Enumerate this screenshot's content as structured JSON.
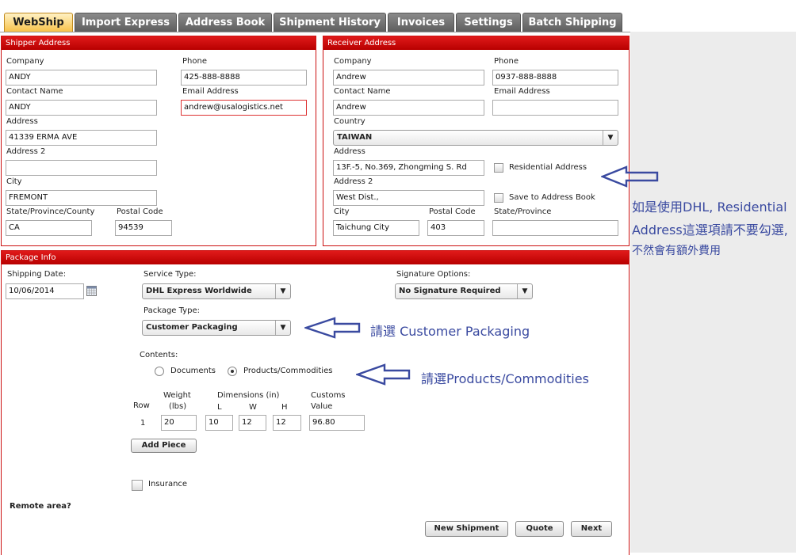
{
  "tabs": [
    "WebShip",
    "Import Express",
    "Address Book",
    "Shipment History",
    "Invoices",
    "Settings",
    "Batch Shipping"
  ],
  "shipper": {
    "title": "Shipper Address",
    "company_label": "Company",
    "company": "ANDY",
    "phone_label": "Phone",
    "phone": "425-888-8888",
    "contact_label": "Contact Name",
    "contact": "ANDY",
    "email_label": "Email Address",
    "email": "andrew@usalogistics.net",
    "address_label": "Address",
    "address": "41339 ERMA AVE",
    "address2_label": "Address 2",
    "address2": "",
    "city_label": "City",
    "city": "FREMONT",
    "state_label": "State/Province/County",
    "state": "CA",
    "postal_label": "Postal Code",
    "postal": "94539"
  },
  "receiver": {
    "title": "Receiver Address",
    "company_label": "Company",
    "company": "Andrew",
    "phone_label": "Phone",
    "phone": "0937-888-8888",
    "contact_label": "Contact Name",
    "contact": "Andrew",
    "email_label": "Email Address",
    "email": "",
    "country_label": "Country",
    "country": "TAIWAN",
    "address_label": "Address",
    "address": "13F.-5, No.369, Zhongming S. Rd",
    "residential_label": "Residential Address",
    "address2_label": "Address 2",
    "address2": "West Dist.,",
    "save_label": "Save to Address Book",
    "city_label": "City",
    "city": "Taichung City",
    "postal_label": "Postal Code",
    "postal": "403",
    "state_label": "State/Province",
    "state": ""
  },
  "package": {
    "title": "Package Info",
    "date_label": "Shipping Date:",
    "date": "10/06/2014",
    "service_label": "Service Type:",
    "service": "DHL Express Worldwide",
    "signature_label": "Signature Options:",
    "signature": "No Signature Required",
    "package_type_label": "Package Type:",
    "package_type": "Customer Packaging",
    "contents_label": "Contents:",
    "documents_label": "Documents",
    "products_label": "Products/Commodities",
    "row_header": "Row",
    "weight_header": "Weight",
    "weight_unit": "(lbs)",
    "dimensions_header": "Dimensions (in)",
    "l_header": "L",
    "w_header": "W",
    "h_header": "H",
    "customs_header": "Customs",
    "customs_unit": "Value",
    "row": {
      "num": "1",
      "weight": "20",
      "l": "10",
      "w": "12",
      "h": "12",
      "value": "96.80"
    },
    "add_piece": "Add Piece",
    "insurance_label": "Insurance",
    "remote_label": "Remote area?"
  },
  "buttons": {
    "new_shipment": "New Shipment",
    "quote": "Quote",
    "next": "Next"
  },
  "annotations": {
    "residential_line1": "如是使用DHL, Residential",
    "residential_line2": "Address這選項請不要勾選,",
    "residential_line3": "不然會有額外費用",
    "packaging": "請選 Customer Packaging",
    "products": "請選Products/Commodities"
  }
}
